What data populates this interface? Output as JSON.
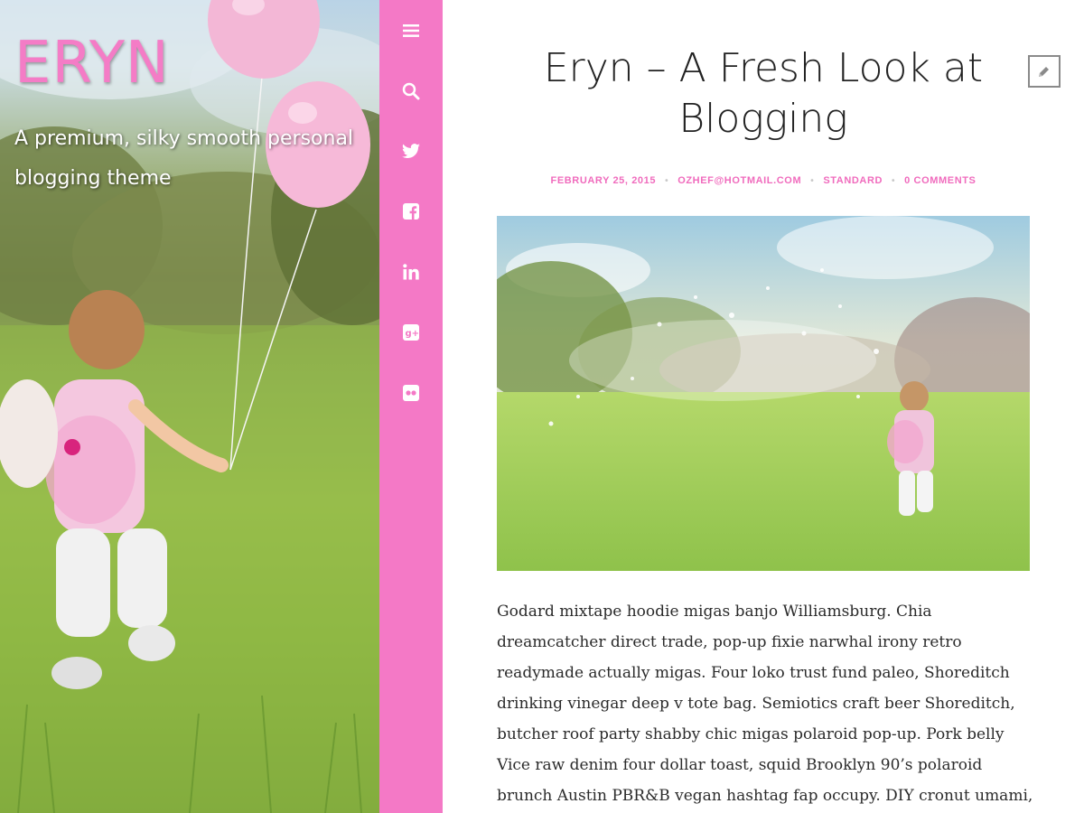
{
  "site": {
    "title": "ERYN",
    "tagline": "A premium, silky smooth personal blogging theme"
  },
  "icon_strip": {
    "background": "#f479c6",
    "icons": [
      "menu-icon",
      "search-icon",
      "twitter-icon",
      "facebook-icon",
      "linkedin-icon",
      "google-plus-icon",
      "flickr-icon"
    ]
  },
  "post": {
    "title": "Eryn – A Fresh Look at Blogging",
    "meta": {
      "date": "FEBRUARY 25, 2015",
      "author": "OZHEF@HOTMAIL.COM",
      "format": "STANDARD",
      "comments": "0 COMMENTS"
    },
    "body": "Godard mixtape hoodie migas banjo Williamsburg. Chia dreamcatcher direct trade, pop-up fixie narwhal irony retro readymade actually migas. Four loko trust fund paleo, Shoreditch drinking vinegar deep v tote bag. Semiotics craft beer Shoreditch, butcher roof party shabby chic migas polaroid pop-up. Pork belly Vice raw denim four dollar toast, squid Brooklyn 90’s polaroid brunch Austin PBR&B vegan hashtag fap occupy. DIY cronut umami,"
  },
  "colors": {
    "accent_pink": "#f06bbd",
    "title_text": "#222222",
    "body_text": "#2b2b2b"
  }
}
